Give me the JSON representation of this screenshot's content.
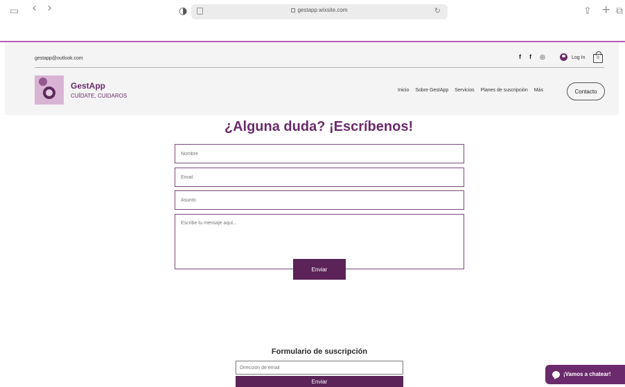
{
  "browser": {
    "url": "gestapp.wixsite.com",
    "icons": {
      "sidebar": "▭",
      "back": "‹",
      "forward": "›",
      "shield": "◑",
      "share": "⇪",
      "new_tab": "+",
      "tabs": "⧉",
      "reload": "↻"
    }
  },
  "header": {
    "email": "gestapp@outlook.com",
    "social": [
      "f",
      "f",
      "◎"
    ],
    "login_label": "Log In",
    "cart_count": "0",
    "brand_name": "GestApp",
    "brand_tagline": "CUÍDATE, CUIDAROS",
    "nav_items": [
      "Inicio",
      "Sobre GestApp",
      "Servicios",
      "Planes de suscripción",
      "Más"
    ],
    "contact_label": "Contacto"
  },
  "contact_form": {
    "title": "¿Alguna duda? ¡Escríbenos!",
    "name_placeholder": "Nombre",
    "email_placeholder": "Email",
    "subject_placeholder": "Asunto",
    "message_placeholder": "Escribe tu mensaje aquí...",
    "send_label": "Enviar"
  },
  "subscription": {
    "title": "Formulario de suscripción",
    "email_placeholder": "Dirección de email",
    "send_label": "Enviar"
  },
  "chat": {
    "label": "¡Vamos a chatear!"
  },
  "colors": {
    "brand": "#6b2a6b",
    "button": "#5b2358",
    "accent_line": "#b65ab5",
    "header_bg": "#f4f4f4"
  }
}
